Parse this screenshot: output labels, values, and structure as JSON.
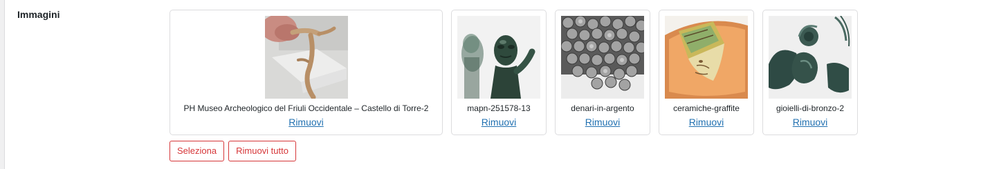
{
  "field": {
    "label": "Immagini"
  },
  "images": [
    {
      "caption": "PH Museo Archeologico del Friuli Occidentale – Castello di Torre-2",
      "remove_label": "Rimuovi",
      "icon": "bone-fibula-photo"
    },
    {
      "caption": "mapn-251578-13",
      "remove_label": "Rimuovi",
      "icon": "bronze-figurine-photo"
    },
    {
      "caption": "denari-in-argento",
      "remove_label": "Rimuovi",
      "icon": "silver-coins-photo"
    },
    {
      "caption": "ceramiche-graffite",
      "remove_label": "Rimuovi",
      "icon": "ceramic-bowl-photo"
    },
    {
      "caption": "gioielli-di-bronzo-2",
      "remove_label": "Rimuovi",
      "icon": "bronze-jewels-photo"
    }
  ],
  "actions": {
    "select_label": "Seleziona",
    "remove_all_label": "Rimuovi tutto"
  },
  "colors": {
    "link": "#2271b1",
    "danger": "#d63638",
    "border": "#dcdcde",
    "text": "#1d2327"
  }
}
